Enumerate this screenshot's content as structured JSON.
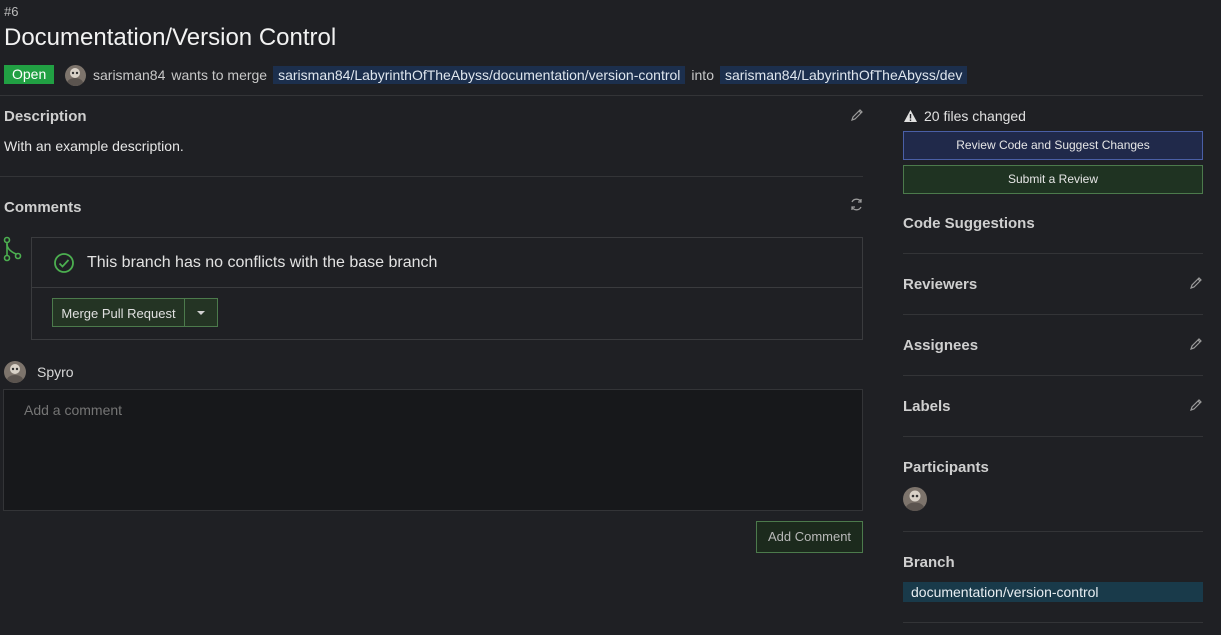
{
  "pr": {
    "number": "#6",
    "title": "Documentation/Version Control",
    "status": "Open",
    "author": "sarisman84",
    "wants_to_merge": "wants to merge",
    "source_branch": "sarisman84/LabyrinthOfTheAbyss/documentation/version-control",
    "into": "into",
    "target_branch": "sarisman84/LabyrinthOfTheAbyss/dev"
  },
  "description": {
    "title": "Description",
    "text": "With an example description."
  },
  "comments": {
    "title": "Comments",
    "merge_status": "This branch has no conflicts with the base branch",
    "merge_button": "Merge Pull Request",
    "current_user": "Spyro",
    "comment_placeholder": "Add a comment",
    "add_comment_button": "Add Comment"
  },
  "sidebar": {
    "files_changed": "20 files changed",
    "review_button": "Review Code and Suggest Changes",
    "submit_review_button": "Submit a Review",
    "code_suggestions": "Code Suggestions",
    "reviewers": "Reviewers",
    "assignees": "Assignees",
    "labels": "Labels",
    "participants": "Participants",
    "branch_title": "Branch",
    "branch_name": "documentation/version-control"
  },
  "colors": {
    "background": "#1f2024",
    "open_badge": "#21a043",
    "merge_green": "#4c7a4c",
    "review_blue": "#4a5fa6"
  }
}
